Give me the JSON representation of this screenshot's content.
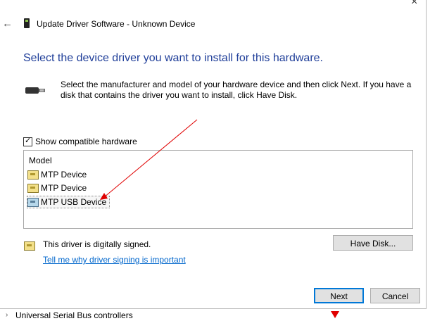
{
  "window": {
    "title": "Update Driver Software - Unknown Device",
    "close_glyph": "×",
    "back_glyph": "←"
  },
  "heading": "Select the device driver you want to install for this hardware.",
  "description": "Select the manufacturer and model of your hardware device and then click Next. If you have a disk that contains the driver you want to install, click Have Disk.",
  "compatible": {
    "label": "Show compatible hardware",
    "checked": true
  },
  "model_list": {
    "column_header": "Model",
    "items": [
      {
        "label": "MTP Device",
        "icon": "device-icon"
      },
      {
        "label": "MTP Device",
        "icon": "device-icon"
      },
      {
        "label": "MTP USB Device",
        "icon": "device-icon",
        "selected": true
      }
    ]
  },
  "signing": {
    "status_text": "This driver is digitally signed.",
    "link_text": "Tell me why driver signing is important"
  },
  "buttons": {
    "have_disk": "Have Disk...",
    "next": "Next",
    "cancel": "Cancel"
  },
  "background": {
    "device_manager_item": "Universal Serial Bus controllers"
  },
  "annotation_color": "#e00000"
}
